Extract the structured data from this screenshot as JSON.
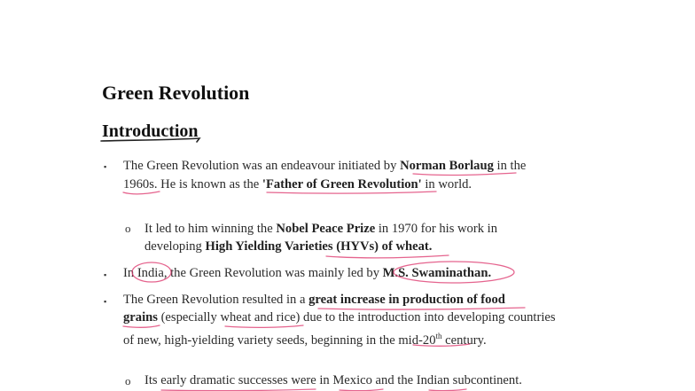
{
  "title": "Green Revolution",
  "section": "Introduction",
  "bullets": {
    "b1": {
      "l1_a": "The Green Revolution was an endeavour initiated by ",
      "l1_b": "Norman Borlaug",
      "l1_c": " in the",
      "l2_a": "1960s",
      "l2_b": ". He is known as the ",
      "l2_c": "'Father of Green Revolution'",
      "l2_d": " in world."
    },
    "s1": {
      "l1_a": "It led to him winning the ",
      "l1_b": "Nobel Peace Prize",
      "l1_c": " in 1970 for his work in",
      "l2_a": "developing ",
      "l2_b": "High Yielding Varieties (HYVs) of wheat."
    },
    "b2": {
      "a": "In ",
      "b": "India",
      "c": ", the Green Revolution was mainly led by ",
      "d": "M.S. Swaminathan."
    },
    "b3": {
      "l1_a": "The Green Revolution resulted in a ",
      "l1_b": "great increase in production of food",
      "l2_a": "grains",
      "l2_b": " (especially ",
      "l2_c": "wheat and rice",
      "l2_d": ") due to the introduction into developing countries",
      "l3_a": "of new, high-yielding variety seeds, beginning in the ",
      "l3_b": "mid-20",
      "l3_sup": "th",
      "l3_c": " century."
    },
    "s2": {
      "text": "Its early dramatic successes were in Mexico and the Indian subcontinent."
    }
  },
  "markers": {
    "square": "▪",
    "circle": "o"
  },
  "colors": {
    "annotation_pink": "#e0497a",
    "text": "#2b2b2b"
  }
}
